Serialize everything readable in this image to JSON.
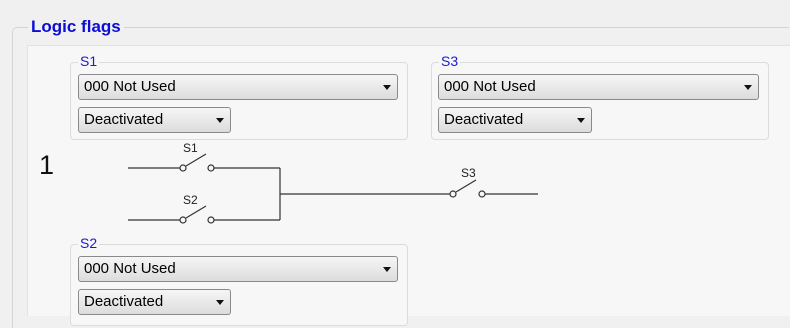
{
  "section_title": "Logic flags",
  "row_number": "1",
  "switches": {
    "s1": {
      "label": "S1",
      "function_value": "000 Not Used",
      "state_value": "Deactivated"
    },
    "s2": {
      "label": "S2",
      "function_value": "000 Not Used",
      "state_value": "Deactivated"
    },
    "s3": {
      "label": "S3",
      "function_value": "000 Not Used",
      "state_value": "Deactivated"
    }
  },
  "diagram_labels": {
    "s1": "S1",
    "s2": "S2",
    "s3": "S3"
  }
}
